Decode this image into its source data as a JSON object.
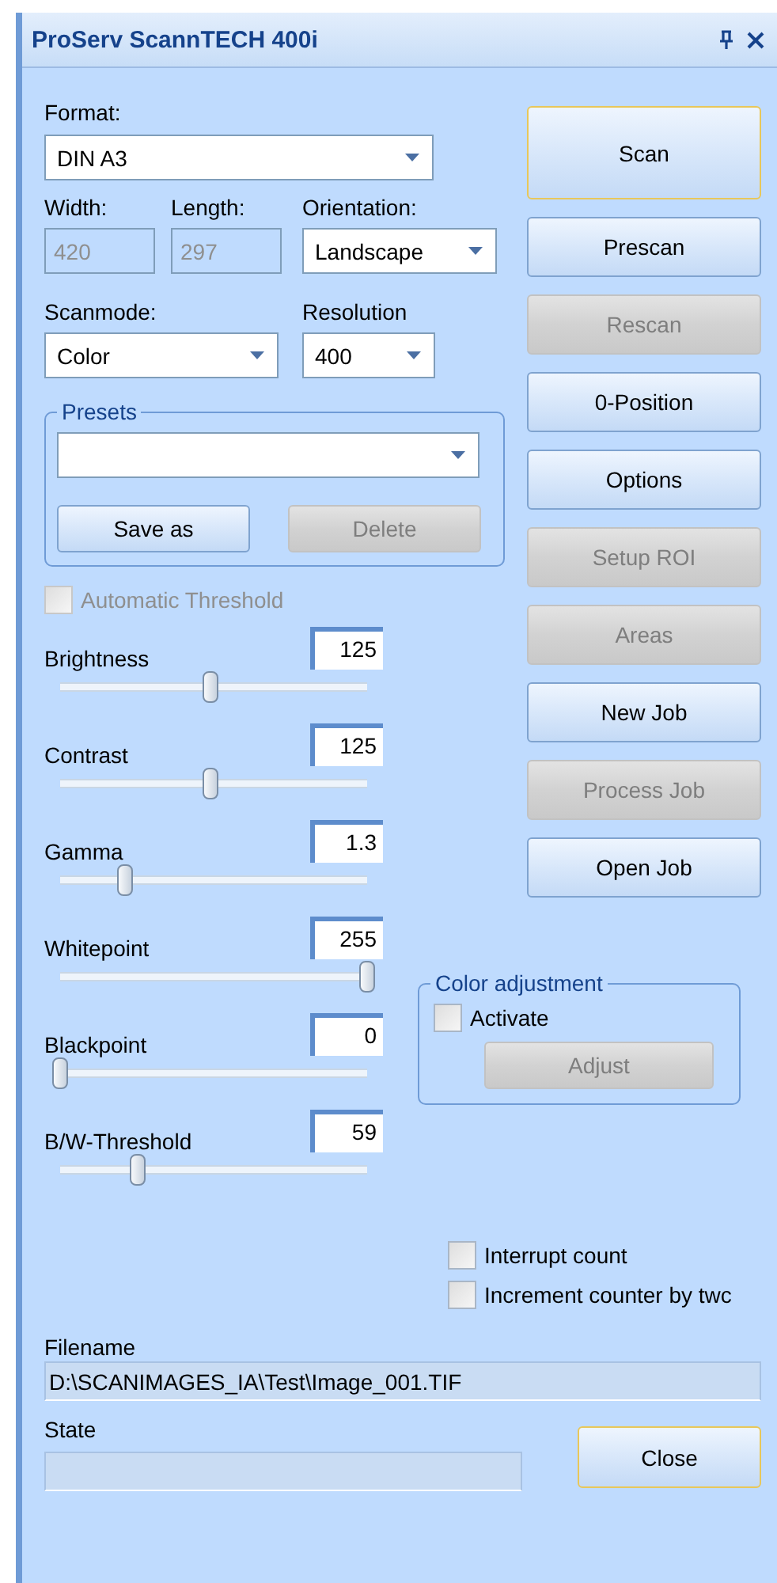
{
  "window": {
    "title": "ProServ ScannTECH 400i"
  },
  "format": {
    "label": "Format:",
    "value": "DIN A3"
  },
  "size": [
    {
      "label": "Width:",
      "value": "420",
      "disabled": true
    },
    {
      "label": "Length:",
      "value": "297",
      "disabled": true
    }
  ],
  "orientation": {
    "label": "Orientation:",
    "value": "Landscape"
  },
  "scanmode": {
    "label": "Scanmode:",
    "value": "Color"
  },
  "resolution": {
    "label": "Resolution",
    "value": "400"
  },
  "presets": {
    "title": "Presets",
    "buttons": [
      {
        "label": "Save as",
        "disabled": false
      },
      {
        "label": "Delete",
        "disabled": true
      }
    ]
  },
  "auto_threshold": {
    "label": "Automatic Threshold",
    "checked": false,
    "disabled": true
  },
  "sliders": [
    {
      "label": "Brightness",
      "value": "125",
      "level": 0.49
    },
    {
      "label": "Contrast",
      "value": "125",
      "level": 0.49
    },
    {
      "label": "Gamma",
      "value": "1.3",
      "level": 0.21
    },
    {
      "label": "Whitepoint",
      "value": "255",
      "level": 1
    },
    {
      "label": "Blackpoint",
      "value": "0",
      "level": 0
    },
    {
      "label": "B/W-Threshold",
      "value": "59",
      "level": 0.25
    }
  ],
  "buttons": [
    {
      "label": "Scan",
      "disabled": false,
      "default": true
    },
    {
      "label": "Prescan",
      "disabled": false,
      "default": false
    },
    {
      "label": "Rescan",
      "disabled": true,
      "default": false
    },
    {
      "label": "0-Position",
      "disabled": false,
      "default": false
    },
    {
      "label": "Options",
      "disabled": false,
      "default": false
    },
    {
      "label": "Setup ROI",
      "disabled": true,
      "default": false
    },
    {
      "label": "Areas",
      "disabled": true,
      "default": false
    },
    {
      "label": "New Job",
      "disabled": false,
      "default": false
    },
    {
      "label": "Process Job",
      "disabled": true,
      "default": false
    },
    {
      "label": "Open Job",
      "disabled": false,
      "default": false
    }
  ],
  "color_adjustment": {
    "title": "Color adjustment",
    "activate": {
      "label": "Activate",
      "checked": false
    },
    "button": {
      "label": "Adjust",
      "disabled": true
    }
  },
  "options": [
    {
      "label": "Interrupt count",
      "checked": false
    },
    {
      "label": "Increment counter by twc",
      "checked": false
    }
  ],
  "filename": {
    "label": "Filename",
    "value": "D:\\SCANIMAGES_IA\\Test\\Image_001.TIF"
  },
  "state": {
    "label": "State"
  },
  "close_button": {
    "label": "Close",
    "disabled": false,
    "default": true
  }
}
